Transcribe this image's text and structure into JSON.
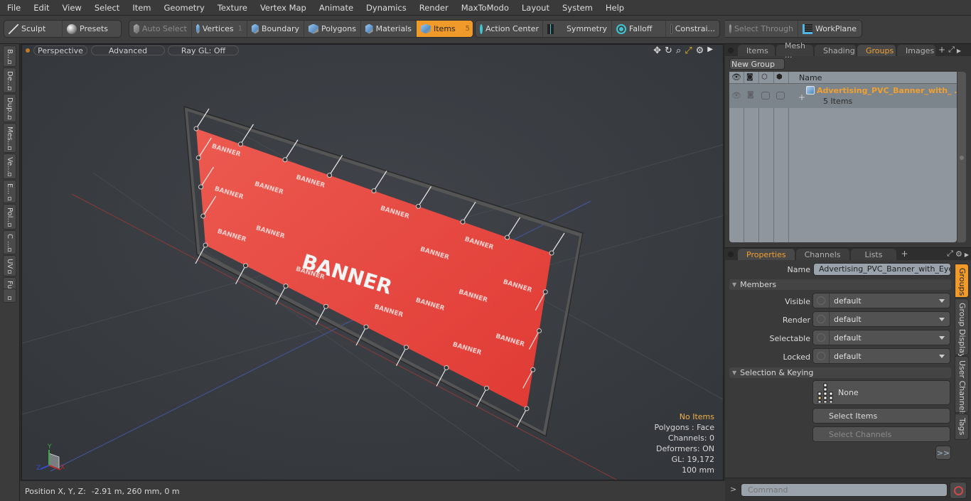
{
  "menu": [
    "File",
    "Edit",
    "View",
    "Select",
    "Item",
    "Geometry",
    "Texture",
    "Vertex Map",
    "Animate",
    "Dynamics",
    "Render",
    "MaxToModo",
    "Layout",
    "System",
    "Help"
  ],
  "toolbar": {
    "sculpt": "Sculpt",
    "presets": "Presets",
    "auto_select": "Auto Select",
    "vertices": "Vertices",
    "vertices_count": "1",
    "boundary": "Boundary",
    "polygons": "Polygons",
    "materials": "Materials",
    "items": "Items",
    "items_count": "5",
    "action_center": "Action Center",
    "symmetry": "Symmetry",
    "falloff": "Falloff",
    "constraints": "Constrai...",
    "select_through": "Select Through",
    "workplane": "WorkPlane"
  },
  "left_tabs": [
    "B...",
    "De...",
    "Dup...",
    "Mes...",
    "Ve...",
    "E...",
    "Pol...",
    "C ...",
    "UV",
    "Fu..."
  ],
  "viewport": {
    "view_mode": "Perspective",
    "shading": "Advanced",
    "raygl": "Ray GL: Off",
    "banner_text": "BANNER",
    "info": {
      "selection": "No Items",
      "polygons": "Polygons : Face",
      "channels": "Channels: 0",
      "deformers": "Deformers: ON",
      "gl": "GL: 19,172",
      "scale": "100 mm"
    },
    "axes": {
      "y": "Y",
      "z": "Z",
      "x": "X"
    }
  },
  "status": {
    "position_label": "Position X, Y, Z:",
    "position_value": "-2.91 m, 260 mm, 0 m"
  },
  "groups_panel": {
    "tabs": [
      "Items",
      "Mesh ...",
      "Shading",
      "Groups",
      "Images"
    ],
    "active_tab": "Groups",
    "new_group": "New Group",
    "column_name": "Name",
    "group_name": "Advertising_PVC_Banner_with_ ...",
    "group_count": "5 Items"
  },
  "properties_panel": {
    "tabs": [
      "Properties",
      "Channels",
      "Lists"
    ],
    "active_tab": "Properties",
    "name_label": "Name",
    "name_value": "Advertising_PVC_Banner_with_Eyelet",
    "members_section": "Members",
    "fields": [
      {
        "label": "Visible",
        "value": "default"
      },
      {
        "label": "Render",
        "value": "default"
      },
      {
        "label": "Selectable",
        "value": "default"
      },
      {
        "label": "Locked",
        "value": "default"
      }
    ],
    "selection_section": "Selection & Keying",
    "none_label": "None",
    "select_items": "Select Items",
    "select_channels": "Select Channels",
    "more": ">>",
    "side_tabs": [
      "Groups",
      "Group Display",
      "User Channels",
      "Tags"
    ]
  },
  "command": {
    "prompt": ">",
    "placeholder": "Command"
  },
  "colors": {
    "accent": "#f09a2a",
    "banner": "#e8473f",
    "highlight_text": "#f0b04a"
  }
}
